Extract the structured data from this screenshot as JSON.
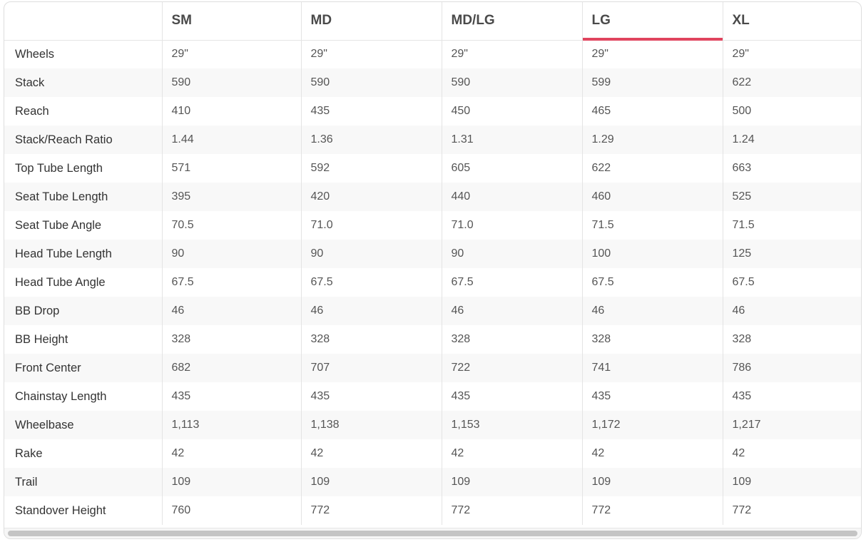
{
  "accent_color": "#e0445e",
  "columns": [
    "",
    "SM",
    "MD",
    "MD/LG",
    "LG",
    "XL"
  ],
  "active_column": "LG",
  "rows": [
    {
      "label": "Wheels",
      "values": [
        "29\"",
        "29\"",
        "29\"",
        "29\"",
        "29\""
      ]
    },
    {
      "label": "Stack",
      "values": [
        "590",
        "590",
        "590",
        "599",
        "622"
      ]
    },
    {
      "label": "Reach",
      "values": [
        "410",
        "435",
        "450",
        "465",
        "500"
      ]
    },
    {
      "label": "Stack/Reach Ratio",
      "values": [
        "1.44",
        "1.36",
        "1.31",
        "1.29",
        "1.24"
      ]
    },
    {
      "label": "Top Tube Length",
      "values": [
        "571",
        "592",
        "605",
        "622",
        "663"
      ]
    },
    {
      "label": "Seat Tube Length",
      "values": [
        "395",
        "420",
        "440",
        "460",
        "525"
      ]
    },
    {
      "label": "Seat Tube Angle",
      "values": [
        "70.5",
        "71.0",
        "71.0",
        "71.5",
        "71.5"
      ]
    },
    {
      "label": "Head Tube Length",
      "values": [
        "90",
        "90",
        "90",
        "100",
        "125"
      ]
    },
    {
      "label": "Head Tube Angle",
      "values": [
        "67.5",
        "67.5",
        "67.5",
        "67.5",
        "67.5"
      ]
    },
    {
      "label": "BB Drop",
      "values": [
        "46",
        "46",
        "46",
        "46",
        "46"
      ]
    },
    {
      "label": "BB Height",
      "values": [
        "328",
        "328",
        "328",
        "328",
        "328"
      ]
    },
    {
      "label": "Front Center",
      "values": [
        "682",
        "707",
        "722",
        "741",
        "786"
      ]
    },
    {
      "label": "Chainstay Length",
      "values": [
        "435",
        "435",
        "435",
        "435",
        "435"
      ]
    },
    {
      "label": "Wheelbase",
      "values": [
        "1,113",
        "1,138",
        "1,153",
        "1,172",
        "1,217"
      ]
    },
    {
      "label": "Rake",
      "values": [
        "42",
        "42",
        "42",
        "42",
        "42"
      ]
    },
    {
      "label": "Trail",
      "values": [
        "109",
        "109",
        "109",
        "109",
        "109"
      ]
    },
    {
      "label": "Standover Height",
      "values": [
        "760",
        "772",
        "772",
        "772",
        "772"
      ]
    }
  ]
}
